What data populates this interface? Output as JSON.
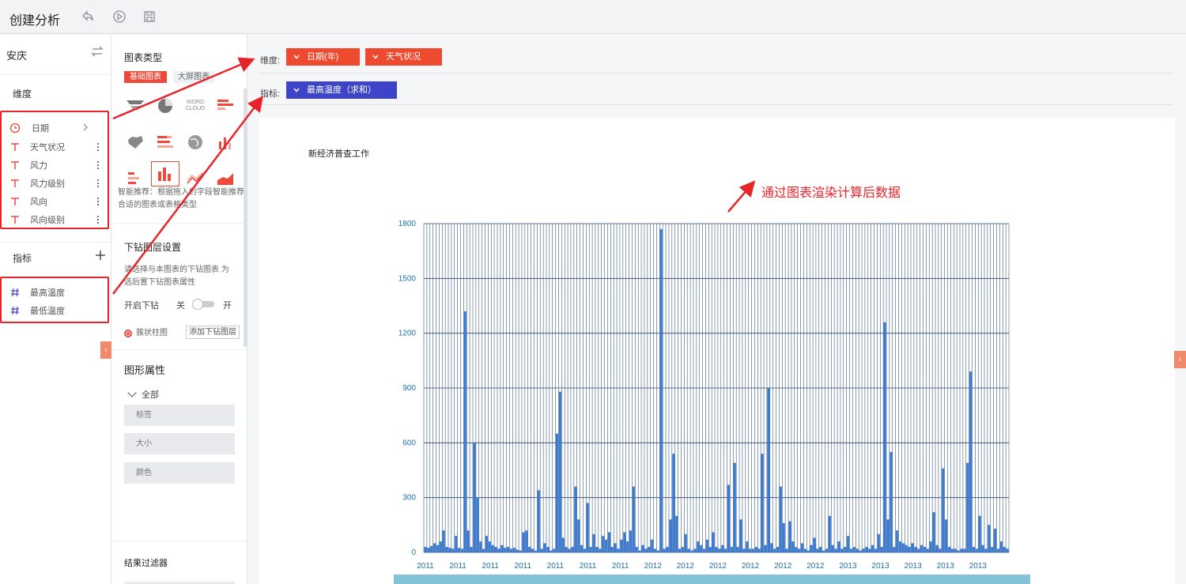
{
  "app": {
    "title": "创建分析",
    "toolbar_icons": [
      "undo-icon",
      "play-icon",
      "save-icon"
    ]
  },
  "left_panel": {
    "datasource": "安庆",
    "dimension_title": "维度",
    "dimensions": [
      {
        "label": "日期",
        "icon": "clock-icon",
        "has_chevron": true
      },
      {
        "label": "天气状况",
        "icon": "text-type-icon"
      },
      {
        "label": "风力",
        "icon": "text-type-icon"
      },
      {
        "label": "风力级别",
        "icon": "text-type-icon"
      },
      {
        "label": "风向",
        "icon": "text-type-icon"
      },
      {
        "label": "风向级别",
        "icon": "text-type-icon"
      }
    ],
    "measure_title": "指标",
    "measures": [
      {
        "label": "最高温度",
        "icon": "hash-icon"
      },
      {
        "label": "最低温度",
        "icon": "hash-icon"
      }
    ]
  },
  "config_panel": {
    "chart_type_title": "图表类型",
    "tabs": [
      "基础图表",
      "大屏图表"
    ],
    "chart_type_icons": [
      "funnel-chart-icon",
      "pie-chart-icon",
      "word-cloud-icon",
      "hbar-chart-icon",
      "map-chart-icon",
      "stacked-hbar-icon",
      "globe-chart-icon",
      "column-line-icon",
      "stacked-bar-icon",
      "column-chart-icon",
      "line-chart-icon",
      "area-chart-icon"
    ],
    "word_cloud_text": "WORD CLOUD",
    "hint": "智能推荐：根据拖入的字段智能推荐合适的图表或表格类型",
    "drill_title": "下钻图层设置",
    "drill_desc": "请选择与本图表的下钻图表 为选后置下钻图表属性",
    "drill_toggle_label": "开启下钻",
    "toggle_off": "关",
    "toggle_on": "开",
    "drill_layer": "簇状柱图",
    "add_drill": "添加下钻图层",
    "shape_title": "图形属性",
    "shape_all": "全部",
    "shape_props": [
      "标签",
      "大小",
      "颜色"
    ],
    "filter_title": "结果过滤器"
  },
  "shelves": {
    "dimension_label": "维度:",
    "dimension_pills": [
      "日期(年)",
      "天气状况"
    ],
    "measure_label": "指标:",
    "measure_pills": [
      "最高温度（求和）"
    ]
  },
  "annotation": "通过图表渲染计算后数据",
  "chart_data": {
    "type": "bar",
    "title": "新经济普查工作",
    "ylim": [
      0,
      1800
    ],
    "yticks": [
      0,
      300,
      600,
      900,
      1200,
      1500,
      1800
    ],
    "x_group_labels": [
      "2011",
      "2011",
      "2011",
      "2011",
      "2011",
      "2011",
      "2011",
      "2012",
      "2012",
      "2012",
      "2012",
      "2012",
      "2012",
      "2013",
      "2013",
      "2013",
      "2013",
      "2013"
    ],
    "grid": true,
    "color": "#3a7bd5",
    "values": [
      30,
      25,
      35,
      50,
      40,
      60,
      120,
      30,
      25,
      20,
      90,
      25,
      20,
      1320,
      120,
      30,
      600,
      300,
      60,
      20,
      90,
      60,
      40,
      30,
      20,
      40,
      25,
      30,
      20,
      25,
      15,
      10,
      110,
      120,
      30,
      20,
      10,
      340,
      20,
      50,
      30,
      10,
      20,
      650,
      880,
      80,
      30,
      20,
      30,
      360,
      180,
      40,
      20,
      270,
      30,
      100,
      30,
      20,
      90,
      70,
      110,
      30,
      50,
      20,
      70,
      110,
      60,
      120,
      360,
      30,
      10,
      40,
      20,
      30,
      70,
      20,
      10,
      1770,
      20,
      30,
      180,
      540,
      200,
      20,
      30,
      100,
      20,
      10,
      20,
      60,
      40,
      20,
      70,
      30,
      110,
      30,
      20,
      40,
      20,
      370,
      30,
      490,
      30,
      180,
      20,
      60,
      20,
      20,
      30,
      20,
      540,
      40,
      900,
      50,
      20,
      30,
      360,
      160,
      20,
      170,
      60,
      30,
      20,
      50,
      20,
      10,
      40,
      80,
      20,
      30,
      10,
      20,
      200,
      40,
      20,
      60,
      20,
      30,
      90,
      20,
      30,
      20,
      10,
      20,
      30,
      20,
      40,
      20,
      100,
      30,
      1260,
      180,
      550,
      30,
      120,
      60,
      50,
      40,
      30,
      50,
      30,
      20,
      40,
      30,
      20,
      60,
      220,
      40,
      20,
      460,
      180,
      30,
      20,
      20,
      10,
      20,
      20,
      490,
      990,
      30,
      20,
      200,
      40,
      20,
      150,
      30,
      130,
      20,
      60,
      30,
      20
    ]
  }
}
